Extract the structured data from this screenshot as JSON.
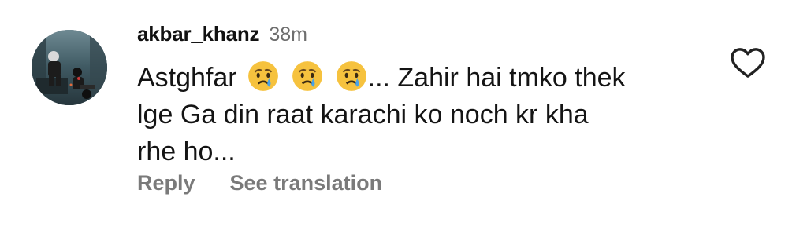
{
  "comment": {
    "username": "akbar_khanz",
    "time": "38m",
    "text_start": "Astghfar",
    "emojis": [
      "crying-face",
      "crying-face",
      "crying-face"
    ],
    "line1_rest": "... Zahir hai tmko thek",
    "line2": "lge Ga din raat karachi ko noch kr kha",
    "line3": "rhe ho...",
    "actions": {
      "reply": "Reply",
      "translate": "See translation"
    },
    "like_icon": "heart-outline-icon"
  },
  "colors": {
    "username": "#111111",
    "meta": "#6e6e6e",
    "action": "#7a7a7a",
    "emoji_face": "#f6c23e",
    "tear": "#4aa3e8"
  }
}
